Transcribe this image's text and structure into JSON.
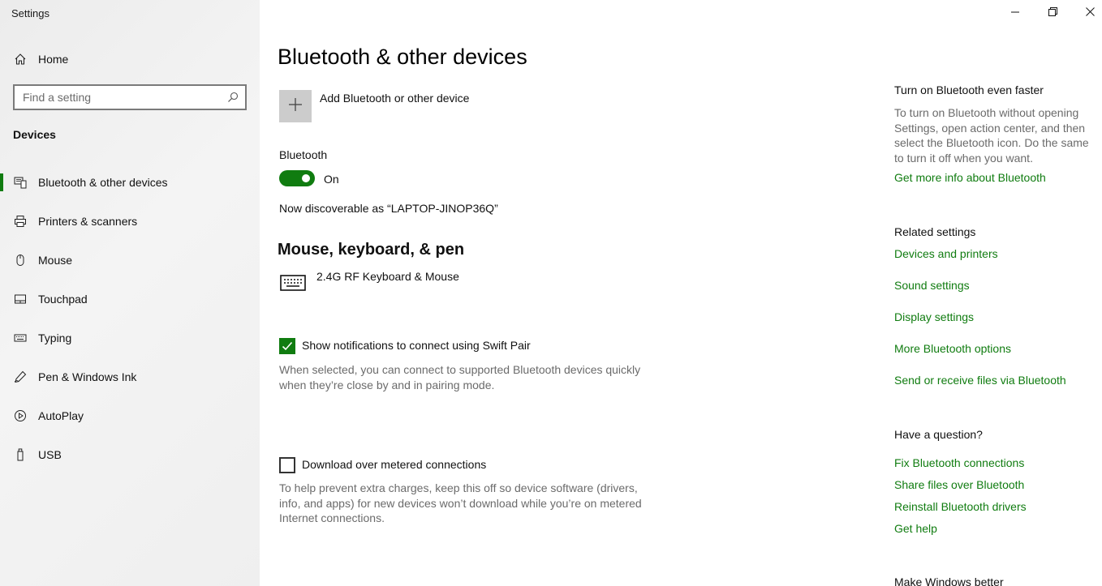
{
  "window": {
    "title": "Settings",
    "controls": [
      "minimize-icon",
      "restore-icon",
      "close-icon"
    ]
  },
  "sidebar": {
    "home_label": "Home",
    "search": {
      "placeholder": "Find a setting",
      "icon": "search-icon"
    },
    "section_label": "Devices",
    "items": [
      {
        "label": "Bluetooth & other devices",
        "icon": "bluetooth-devices-icon",
        "active": true
      },
      {
        "label": "Printers & scanners",
        "icon": "printer-icon"
      },
      {
        "label": "Mouse",
        "icon": "mouse-icon"
      },
      {
        "label": "Touchpad",
        "icon": "touchpad-icon"
      },
      {
        "label": "Typing",
        "icon": "keyboard-icon"
      },
      {
        "label": "Pen & Windows Ink",
        "icon": "pen-icon"
      },
      {
        "label": "AutoPlay",
        "icon": "autoplay-icon"
      },
      {
        "label": "USB",
        "icon": "usb-icon"
      }
    ]
  },
  "main": {
    "title": "Bluetooth & other devices",
    "add_device_label": "Add Bluetooth or other device",
    "bluetooth": {
      "label": "Bluetooth",
      "state": "On",
      "on": true,
      "discoverable_text": "Now discoverable as “LAPTOP-JINOP36Q”"
    },
    "mouse_keyboard_pen": {
      "heading": "Mouse, keyboard, & pen",
      "devices": [
        {
          "name": "2.4G RF Keyboard & Mouse",
          "icon": "keyboard-icon"
        }
      ]
    },
    "swift_pair": {
      "label": "Show notifications to connect using Swift Pair",
      "checked": true,
      "description": "When selected, you can connect to supported Bluetooth devices quickly when they’re close by and in pairing mode."
    },
    "metered": {
      "label": "Download over metered connections",
      "checked": false,
      "description": "To help prevent extra charges, keep this off so device software (drivers, info, and apps) for new devices won’t download while you’re on metered Internet connections."
    }
  },
  "right": {
    "faster": {
      "heading": "Turn on Bluetooth even faster",
      "text": "To turn on Bluetooth without opening Settings, open action center, and then select the Bluetooth icon. Do the same to turn it off when you want.",
      "link": "Get more info about Bluetooth"
    },
    "related": {
      "heading": "Related settings",
      "links": [
        "Devices and printers",
        "Sound settings",
        "Display settings",
        "More Bluetooth options",
        "Send or receive files via Bluetooth"
      ]
    },
    "question": {
      "heading": "Have a question?",
      "links": [
        "Fix Bluetooth connections",
        "Share files over Bluetooth",
        "Reinstall Bluetooth drivers",
        "Get help"
      ]
    },
    "better_heading": "Make Windows better"
  },
  "colors": {
    "accent": "#107c10",
    "secondary_text": "#6b6b6b",
    "sidebar_bg": "#f0f0f0"
  }
}
